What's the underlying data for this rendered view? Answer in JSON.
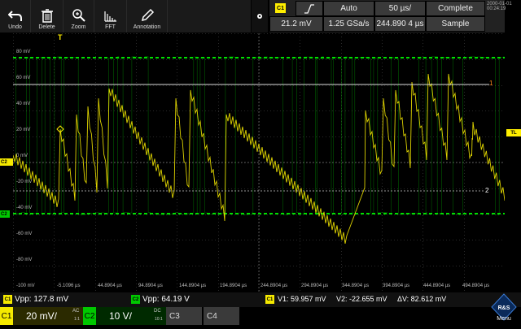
{
  "toolbar": {
    "undo": "Undo",
    "delete": "Delete",
    "zoom": "Zoom",
    "fft": "FFT",
    "annotation": "Annotation"
  },
  "info": {
    "channel": "C1",
    "slope_icon": "rising-edge-icon",
    "mode": "Auto",
    "timebase": "50 µs/",
    "acq_status": "Complete",
    "trigger_level": "21.2 mV",
    "sample_rate": "1.25 GSa/s",
    "time_position": "244.890 4 µs",
    "acq_mode": "Sample",
    "date": "2000-01-01",
    "time": "00:24:19"
  },
  "markers": {
    "trigger_top": "T",
    "c2_offset": "C2",
    "c1_offset": "C2",
    "trigger_level": "TL",
    "cursor_v1": "1",
    "cursor_v2": "2"
  },
  "y_ticks": [
    "80 mV",
    "60 mV",
    "40 mV",
    "20 mV",
    "0 mV",
    "-20 mV",
    "-40 mV",
    "-60 mV",
    "-80 mV",
    "-100 mV"
  ],
  "x_ticks": [
    "-5.1096 µs",
    "44.8904 µs",
    "94.8904 µs",
    "144.8904 µs",
    "194.8904 µs",
    "244.8904 µs",
    "294.8904 µs",
    "344.8904 µs",
    "394.8904 µs",
    "444.8904 µs",
    "494.8904 µs"
  ],
  "measurements": {
    "c1_label": "C1",
    "c1_vpp": "Vpp: 127.8 mV",
    "c2_label": "C2",
    "c2_vpp": "Vpp: 64.19 V",
    "cursor_label": "C1",
    "v1": "V1: 59.957 mV",
    "v2": "V2: -22.655 mV",
    "dv": "ΔV: 82.612 mV"
  },
  "channels": {
    "c1": {
      "name": "C1",
      "scale": "20 mV/",
      "coupling": "AC",
      "probe": "1:1"
    },
    "c2": {
      "name": "C2",
      "scale": "10 V/",
      "coupling": "DC",
      "probe": "10:1"
    },
    "c3": {
      "name": "C3"
    },
    "c4": {
      "name": "C4"
    }
  },
  "menu_label": "Menu",
  "colors": {
    "c1": "#f5e900",
    "c2": "#00c800",
    "accent": "#ffee00"
  }
}
